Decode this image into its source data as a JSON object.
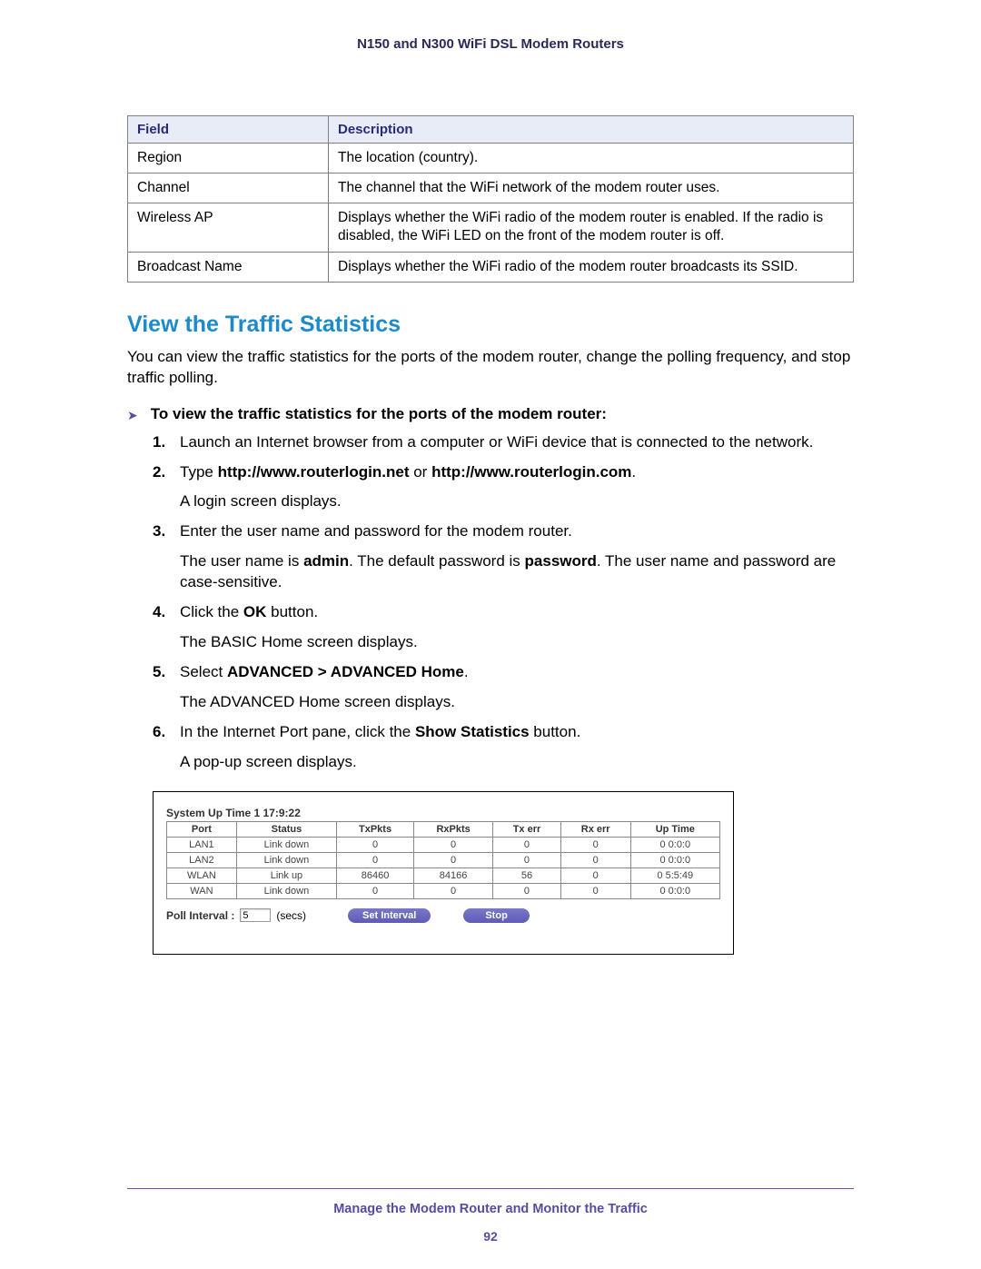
{
  "header": {
    "title": "N150 and N300 WiFi DSL Modem Routers"
  },
  "desc_table": {
    "head": {
      "field": "Field",
      "description": "Description"
    },
    "rows": [
      {
        "field": "Region",
        "desc": "The location (country)."
      },
      {
        "field": "Channel",
        "desc": "The channel that the WiFi network of the modem router uses."
      },
      {
        "field": "Wireless AP",
        "desc": "Displays whether the WiFi radio of the modem router is enabled. If the radio is disabled, the WiFi LED on the front of the modem router is off."
      },
      {
        "field": "Broadcast Name",
        "desc": "Displays whether the WiFi radio of the modem router broadcasts its SSID."
      }
    ]
  },
  "section": {
    "heading": "View the Traffic Statistics",
    "intro": "You can view the traffic statistics for the ports of the modem router, change the polling frequency, and stop traffic polling.",
    "procedure_title": "To view the traffic statistics for the ports of the modem router:",
    "steps": {
      "s1": "Launch an Internet browser from a computer or WiFi device that is connected to the network.",
      "s2a": "Type ",
      "s2b": "http://www.routerlogin.net",
      "s2c": " or ",
      "s2d": "http://www.routerlogin.com",
      "s2e": ".",
      "s2sub": "A login screen displays.",
      "s3": "Enter the user name and password for the modem router.",
      "s3sub_a": "The user name is ",
      "s3sub_b": "admin",
      "s3sub_c": ". The default password is ",
      "s3sub_d": "password",
      "s3sub_e": ". The user name and password are case-sensitive.",
      "s4a": "Click the ",
      "s4b": "OK",
      "s4c": " button.",
      "s4sub": "The BASIC Home screen displays.",
      "s5a": "Select ",
      "s5b": "ADVANCED > ADVANCED Home",
      "s5c": ".",
      "s5sub": "The ADVANCED Home screen displays.",
      "s6a": "In the Internet Port pane, click the ",
      "s6b": "Show Statistics",
      "s6c": " button.",
      "s6sub": "A pop-up screen displays."
    }
  },
  "popup": {
    "sysup_label": "System Up Time",
    "sysup_value": "1 17:9:22",
    "head": {
      "port": "Port",
      "status": "Status",
      "tx": "TxPkts",
      "rx": "RxPkts",
      "txe": "Tx err",
      "rxe": "Rx err",
      "up": "Up Time"
    },
    "rows": [
      {
        "port": "LAN1",
        "status": "Link down",
        "tx": "0",
        "rx": "0",
        "txe": "0",
        "rxe": "0",
        "up": "0 0:0:0"
      },
      {
        "port": "LAN2",
        "status": "Link down",
        "tx": "0",
        "rx": "0",
        "txe": "0",
        "rxe": "0",
        "up": "0 0:0:0"
      },
      {
        "port": "WLAN",
        "status": "Link up",
        "tx": "86460",
        "rx": "84166",
        "txe": "56",
        "rxe": "0",
        "up": "0 5:5:49"
      },
      {
        "port": "WAN",
        "status": "Link down",
        "tx": "0",
        "rx": "0",
        "txe": "0",
        "rxe": "0",
        "up": "0 0:0:0"
      }
    ],
    "poll_label": "Poll Interval :",
    "poll_value": "5",
    "poll_unit": "(secs)",
    "btn_set": "Set Interval",
    "btn_stop": "Stop"
  },
  "footer": {
    "text": "Manage the Modem Router and Monitor the Traffic",
    "page": "92"
  }
}
